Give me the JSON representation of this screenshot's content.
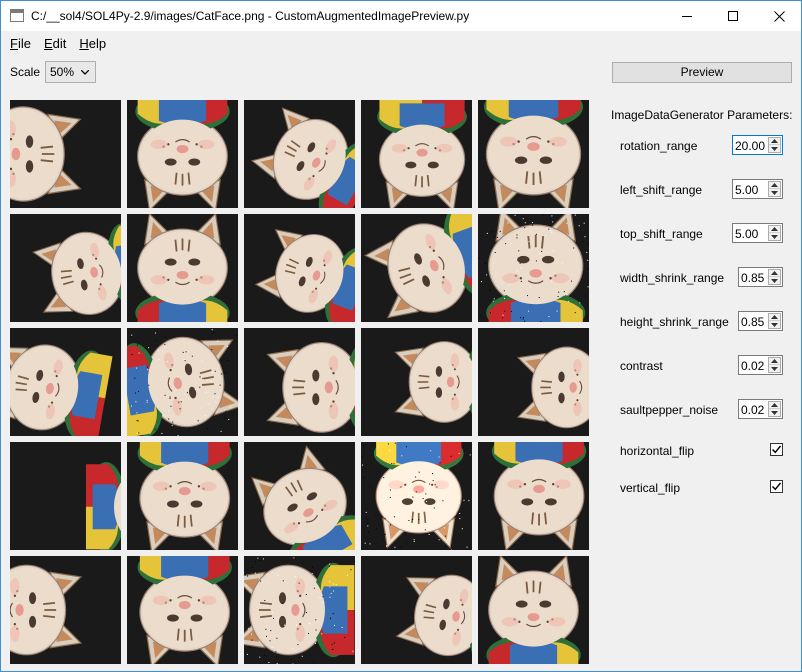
{
  "window": {
    "title": "C:/__sol4/SOL4Py-2.9/images/CatFace.png - CustomAugmentedImagePreview.py",
    "minimize_icon": "minimize-icon",
    "maximize_icon": "maximize-icon",
    "close_icon": "close-icon"
  },
  "menu": {
    "items": [
      {
        "label": "File",
        "mnemonic": "F",
        "rest": "ile"
      },
      {
        "label": "Edit",
        "mnemonic": "E",
        "rest": "dit"
      },
      {
        "label": "Help",
        "mnemonic": "H",
        "rest": "elp"
      }
    ]
  },
  "toolbar": {
    "scale_label": "Scale",
    "scale_value": "50%",
    "preview_label": "Preview"
  },
  "params": {
    "title": "ImageDataGenerator Parameters:",
    "items": [
      {
        "label": "rotation_range",
        "value": "20.00"
      },
      {
        "label": "left_shift_range",
        "value": "5.00"
      },
      {
        "label": "top_shift_range",
        "value": "5.00"
      },
      {
        "label": "width_shrink_range",
        "value": "0.85"
      },
      {
        "label": "height_shrink_range",
        "value": "0.85"
      },
      {
        "label": "contrast",
        "value": "0.02"
      },
      {
        "label": "saultpepper_noise",
        "value": "0.02"
      }
    ],
    "checks": [
      {
        "label": "horizontal_flip",
        "checked": true
      },
      {
        "label": "vertical_flip",
        "checked": true
      }
    ]
  },
  "preview_grid": {
    "rows": 5,
    "cols": 5,
    "image_icon": "cat-face-image",
    "tiles": [
      {
        "rotation": 90,
        "flip_h": false,
        "flip_v": false,
        "scale": 1.05,
        "dx": -0.38,
        "dy": 0.0,
        "noise": false,
        "brightness": 1.0
      },
      {
        "rotation": 180,
        "flip_h": false,
        "flip_v": false,
        "scale": 1.0,
        "dx": 0.0,
        "dy": 0.02,
        "noise": false,
        "brightness": 1.0
      },
      {
        "rotation": -60,
        "flip_h": false,
        "flip_v": false,
        "scale": 0.92,
        "dx": 0.1,
        "dy": 0.05,
        "noise": false,
        "brightness": 1.0
      },
      {
        "rotation": 180,
        "flip_h": false,
        "flip_v": false,
        "scale": 0.95,
        "dx": 0.05,
        "dy": 0.05,
        "noise": false,
        "brightness": 1.0
      },
      {
        "rotation": 180,
        "flip_h": false,
        "flip_v": false,
        "scale": 1.05,
        "dx": 0.0,
        "dy": 0.0,
        "noise": false,
        "brightness": 1.0
      },
      {
        "rotation": -100,
        "flip_h": false,
        "flip_v": false,
        "scale": 0.92,
        "dx": 0.2,
        "dy": 0.05,
        "noise": false,
        "brightness": 1.0
      },
      {
        "rotation": 0,
        "flip_h": false,
        "flip_v": false,
        "scale": 1.0,
        "dx": 0.0,
        "dy": 0.0,
        "noise": false,
        "brightness": 1.0
      },
      {
        "rotation": -70,
        "flip_h": false,
        "flip_v": false,
        "scale": 0.88,
        "dx": 0.1,
        "dy": 0.05,
        "noise": false,
        "brightness": 1.0
      },
      {
        "rotation": -110,
        "flip_h": false,
        "flip_v": false,
        "scale": 1.0,
        "dx": 0.1,
        "dy": 0.0,
        "noise": false,
        "brightness": 1.0
      },
      {
        "rotation": 0,
        "flip_h": false,
        "flip_v": false,
        "scale": 1.05,
        "dx": 0.02,
        "dy": -0.02,
        "noise": true,
        "brightness": 1.0
      },
      {
        "rotation": -80,
        "flip_h": false,
        "flip_v": false,
        "scale": 0.95,
        "dx": -0.2,
        "dy": 0.05,
        "noise": false,
        "brightness": 1.0
      },
      {
        "rotation": 80,
        "flip_h": false,
        "flip_v": false,
        "scale": 1.0,
        "dx": 0.02,
        "dy": 0.0,
        "noise": true,
        "brightness": 1.0
      },
      {
        "rotation": -90,
        "flip_h": false,
        "flip_v": false,
        "scale": 1.0,
        "dx": 0.2,
        "dy": 0.05,
        "noise": false,
        "brightness": 1.0
      },
      {
        "rotation": -90,
        "flip_h": false,
        "flip_v": false,
        "scale": 0.9,
        "dx": 0.25,
        "dy": 0.0,
        "noise": false,
        "brightness": 1.0
      },
      {
        "rotation": -90,
        "flip_h": false,
        "flip_v": false,
        "scale": 0.9,
        "dx": 0.3,
        "dy": 0.05,
        "noise": false,
        "brightness": 1.0
      },
      {
        "rotation": 90,
        "flip_h": false,
        "flip_v": false,
        "scale": 0.95,
        "dx": 0.75,
        "dy": 0.1,
        "noise": false,
        "brightness": 1.0
      },
      {
        "rotation": 180,
        "flip_h": false,
        "flip_v": false,
        "scale": 1.0,
        "dx": 0.02,
        "dy": 0.02,
        "noise": false,
        "brightness": 1.0
      },
      {
        "rotation": -30,
        "flip_h": false,
        "flip_v": false,
        "scale": 0.95,
        "dx": 0.05,
        "dy": 0.1,
        "noise": false,
        "brightness": 1.0
      },
      {
        "rotation": 180,
        "flip_h": false,
        "flip_v": false,
        "scale": 0.95,
        "dx": 0.02,
        "dy": 0.0,
        "noise": true,
        "brightness": 1.1
      },
      {
        "rotation": 180,
        "flip_h": false,
        "flip_v": false,
        "scale": 1.0,
        "dx": 0.05,
        "dy": 0.0,
        "noise": false,
        "brightness": 1.0
      },
      {
        "rotation": 90,
        "flip_h": false,
        "flip_v": false,
        "scale": 1.0,
        "dx": -0.35,
        "dy": 0.0,
        "noise": false,
        "brightness": 1.0
      },
      {
        "rotation": 180,
        "flip_h": false,
        "flip_v": false,
        "scale": 1.0,
        "dx": 0.02,
        "dy": 0.02,
        "noise": false,
        "brightness": 1.0
      },
      {
        "rotation": -90,
        "flip_h": false,
        "flip_v": false,
        "scale": 1.0,
        "dx": -0.1,
        "dy": 0.0,
        "noise": true,
        "brightness": 1.0
      },
      {
        "rotation": -80,
        "flip_h": false,
        "flip_v": false,
        "scale": 0.9,
        "dx": 0.3,
        "dy": 0.05,
        "noise": false,
        "brightness": 1.0
      },
      {
        "rotation": 0,
        "flip_h": false,
        "flip_v": false,
        "scale": 1.0,
        "dx": 0.0,
        "dy": 0.0,
        "noise": false,
        "brightness": 1.0
      }
    ]
  },
  "colors": {
    "window_bg": "#f0f0f0",
    "titlebar_bg": "#ffffff",
    "accent": "#0078d7",
    "tile_bg": "#1a1a1a"
  }
}
